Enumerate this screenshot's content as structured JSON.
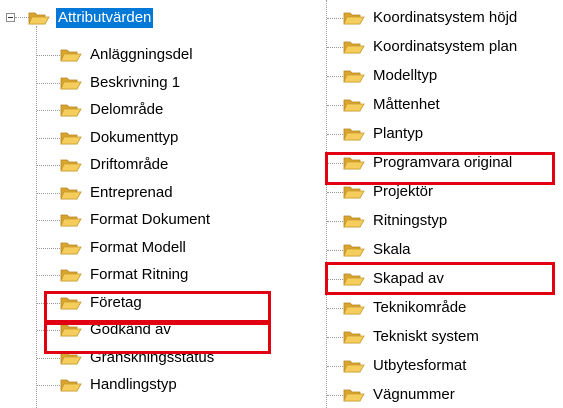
{
  "tree": {
    "root": {
      "label": "Attributvärden",
      "selected": true,
      "expanded": true
    },
    "left_children": [
      {
        "label": "Anläggningsdel"
      },
      {
        "label": "Beskrivning 1"
      },
      {
        "label": "Delområde"
      },
      {
        "label": "Dokumenttyp"
      },
      {
        "label": "Driftområde"
      },
      {
        "label": "Entreprenad"
      },
      {
        "label": "Format Dokument"
      },
      {
        "label": "Format Modell"
      },
      {
        "label": "Format Ritning"
      },
      {
        "label": "Företag",
        "highlighted": true
      },
      {
        "label": "Godkänd av",
        "highlighted": true
      },
      {
        "label": "Granskningsstatus"
      },
      {
        "label": "Handlingstyp"
      }
    ],
    "right_children": [
      {
        "label": "Koordinatsystem höjd"
      },
      {
        "label": "Koordinatsystem plan"
      },
      {
        "label": "Modelltyp"
      },
      {
        "label": "Måttenhet"
      },
      {
        "label": "Plantyp"
      },
      {
        "label": "Programvara original",
        "highlighted": true
      },
      {
        "label": "Projektör"
      },
      {
        "label": "Ritningstyp"
      },
      {
        "label": "Skala"
      },
      {
        "label": "Skapad av",
        "highlighted": true
      },
      {
        "label": "Teknikområde"
      },
      {
        "label": "Tekniskt system"
      },
      {
        "label": "Utbytesformat"
      },
      {
        "label": "Vägnummer"
      }
    ]
  },
  "icons": {
    "folder": "folder-icon",
    "expander": "collapse-minus-icon"
  },
  "colors": {
    "selection": "#0078d7",
    "highlight": "#e00012",
    "folder_front": "#f5cd5c",
    "folder_back": "#d9a52e"
  }
}
